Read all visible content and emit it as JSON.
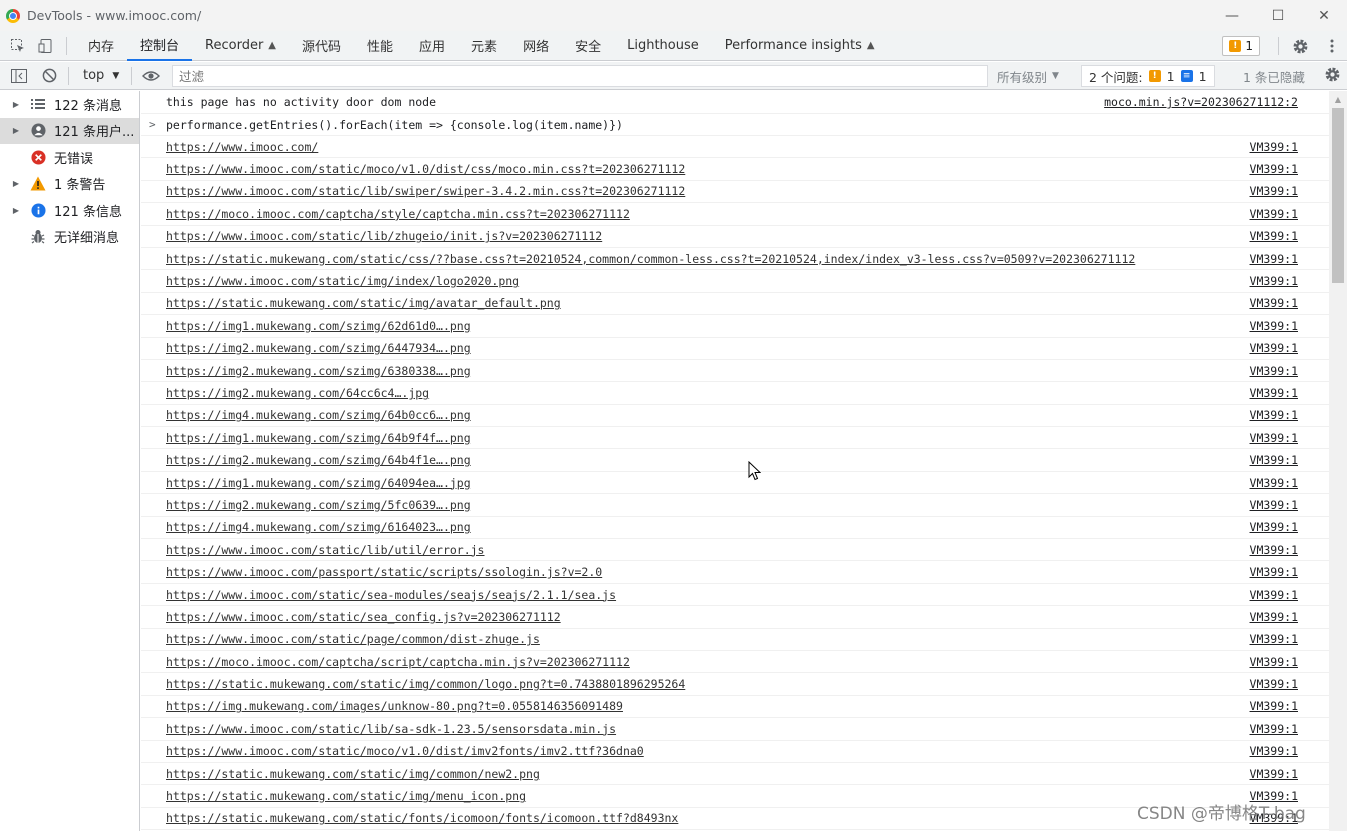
{
  "window": {
    "title": "DevTools - www.imooc.com/",
    "controls": [
      "—",
      "☐",
      "✕"
    ]
  },
  "tabs": [
    {
      "label": "内存",
      "flask": false
    },
    {
      "label": "控制台",
      "flask": false,
      "active": true
    },
    {
      "label": "Recorder",
      "flask": true
    },
    {
      "label": "源代码",
      "flask": false
    },
    {
      "label": "性能",
      "flask": false
    },
    {
      "label": "应用",
      "flask": false
    },
    {
      "label": "元素",
      "flask": false
    },
    {
      "label": "网络",
      "flask": false
    },
    {
      "label": "安全",
      "flask": false
    },
    {
      "label": "Lighthouse",
      "flask": false
    },
    {
      "label": "Performance insights",
      "flask": true
    }
  ],
  "tabbar_right": {
    "issues_badge": "1"
  },
  "toolbar": {
    "context": "top",
    "filter_placeholder": "过滤",
    "levels": "所有级别",
    "issues_label": "2 个问题:",
    "issues_warn": "1",
    "issues_info": "1",
    "hidden": "1 条已隐藏"
  },
  "sidebar": [
    {
      "label": "122 条消息",
      "icon": "list-icon",
      "arrow": true
    },
    {
      "label": "121 条用户...",
      "icon": "user-icon",
      "arrow": true,
      "selected": true
    },
    {
      "label": "无错误",
      "icon": "error-icon",
      "arrow": false
    },
    {
      "label": "1 条警告",
      "icon": "warning-icon",
      "arrow": true
    },
    {
      "label": "121 条信息",
      "icon": "info-icon",
      "arrow": true
    },
    {
      "label": "无详细消息",
      "icon": "bug-icon",
      "arrow": false
    }
  ],
  "console": {
    "first": {
      "text": "this page has no activity door dom node",
      "source": "moco.min.js?v=202306271112:2"
    },
    "command": "performance.getEntries().forEach(item => {console.log(item.name)})",
    "source_default": "VM399:1",
    "entries": [
      "https://www.imooc.com/",
      "https://www.imooc.com/static/moco/v1.0/dist/css/moco.min.css?t=202306271112",
      "https://www.imooc.com/static/lib/swiper/swiper-3.4.2.min.css?t=202306271112",
      "https://moco.imooc.com/captcha/style/captcha.min.css?t=202306271112",
      "https://www.imooc.com/static/lib/zhugeio/init.js?v=202306271112",
      "https://static.mukewang.com/static/css/??base.css?t=20210524,common/common-less.css?t=20210524,index/index_v3-less.css?v=0509?v=202306271112",
      "https://www.imooc.com/static/img/index/logo2020.png",
      "https://static.mukewang.com/static/img/avatar_default.png",
      "https://img1.mukewang.com/szimg/62d61d0….png",
      "https://img2.mukewang.com/szimg/6447934….png",
      "https://img2.mukewang.com/szimg/6380338….png",
      "https://img2.mukewang.com/64cc6c4….jpg",
      "https://img4.mukewang.com/szimg/64b0cc6….png",
      "https://img1.mukewang.com/szimg/64b9f4f….png",
      "https://img2.mukewang.com/szimg/64b4f1e….png",
      "https://img1.mukewang.com/szimg/64094ea….jpg",
      "https://img2.mukewang.com/szimg/5fc0639….png",
      "https://img4.mukewang.com/szimg/6164023….png",
      "https://www.imooc.com/static/lib/util/error.js",
      "https://www.imooc.com/passport/static/scripts/ssologin.js?v=2.0",
      "https://www.imooc.com/static/sea-modules/seajs/seajs/2.1.1/sea.js",
      "https://www.imooc.com/static/sea_config.js?v=202306271112",
      "https://www.imooc.com/static/page/common/dist-zhuge.js",
      "https://moco.imooc.com/captcha/script/captcha.min.js?v=202306271112",
      "https://static.mukewang.com/static/img/common/logo.png?t=0.7438801896295264",
      "https://img.mukewang.com/images/unknow-80.png?t=0.0558146356091489",
      "https://www.imooc.com/static/lib/sa-sdk-1.23.5/sensorsdata.min.js",
      "https://www.imooc.com/static/moco/v1.0/dist/imv2fonts/imv2.ttf?36dna0",
      "https://static.mukewang.com/static/img/common/new2.png",
      "https://static.mukewang.com/static/img/menu_icon.png",
      "https://static.mukewang.com/static/fonts/icomoon/fonts/icomoon.ttf?d8493nx"
    ]
  },
  "watermark": "CSDN @帝博格T-bag",
  "colors": {
    "accent": "#1a73e8",
    "warning": "#f29900",
    "error": "#d93025",
    "info": "#1a73e8"
  }
}
